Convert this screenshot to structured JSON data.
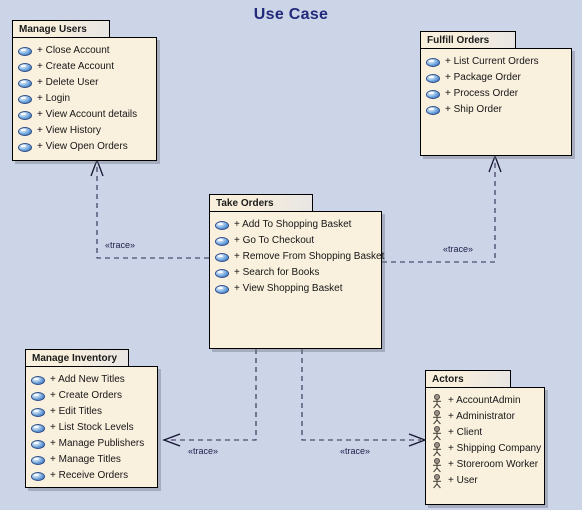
{
  "diagram": {
    "title": "Use Case",
    "background_color": "#ccd4e8",
    "title_color": "#232a7a",
    "package_fill": "#faf0de",
    "package_border": "#000000"
  },
  "packages": [
    {
      "id": "manage-users",
      "name": "Manage Users",
      "icon": "use-case-icon",
      "items": [
        "+ Close Account",
        "+ Create Account",
        "+ Delete User",
        "+ Login",
        "+ View Account details",
        "+ View History",
        "+ View Open Orders"
      ]
    },
    {
      "id": "fulfill-orders",
      "name": "Fulfill Orders",
      "icon": "use-case-icon",
      "items": [
        "+ List Current Orders",
        "+ Package Order",
        "+ Process Order",
        "+ Ship Order"
      ]
    },
    {
      "id": "take-orders",
      "name": "Take Orders",
      "icon": "use-case-icon",
      "items": [
        "+ Add To Shopping Basket",
        "+ Go To Checkout",
        "+ Remove From Shopping Basket",
        "+ Search for Books",
        "+ View Shopping Basket"
      ]
    },
    {
      "id": "manage-inventory",
      "name": "Manage Inventory",
      "icon": "use-case-icon",
      "items": [
        "+ Add New Titles",
        "+ Create Orders",
        "+ Edit Titles",
        "+ List Stock Levels",
        "+ Manage Publishers",
        "+ Manage Titles",
        "+ Receive Orders"
      ]
    },
    {
      "id": "actors",
      "name": "Actors",
      "icon": "actor-icon",
      "items": [
        "+ AccountAdmin",
        "+ Administrator",
        "+ Client",
        "+ Shipping Company",
        "+ Storeroom Worker",
        "+ User"
      ]
    }
  ],
  "connectors": [
    {
      "id": "trace-users",
      "label": "«trace»",
      "from": "take-orders",
      "to": "manage-users"
    },
    {
      "id": "trace-fulfill",
      "label": "«trace»",
      "from": "take-orders",
      "to": "fulfill-orders"
    },
    {
      "id": "trace-inventory",
      "label": "«trace»",
      "from": "take-orders",
      "to": "manage-inventory"
    },
    {
      "id": "trace-actors",
      "label": "«trace»",
      "from": "take-orders",
      "to": "actors"
    }
  ]
}
